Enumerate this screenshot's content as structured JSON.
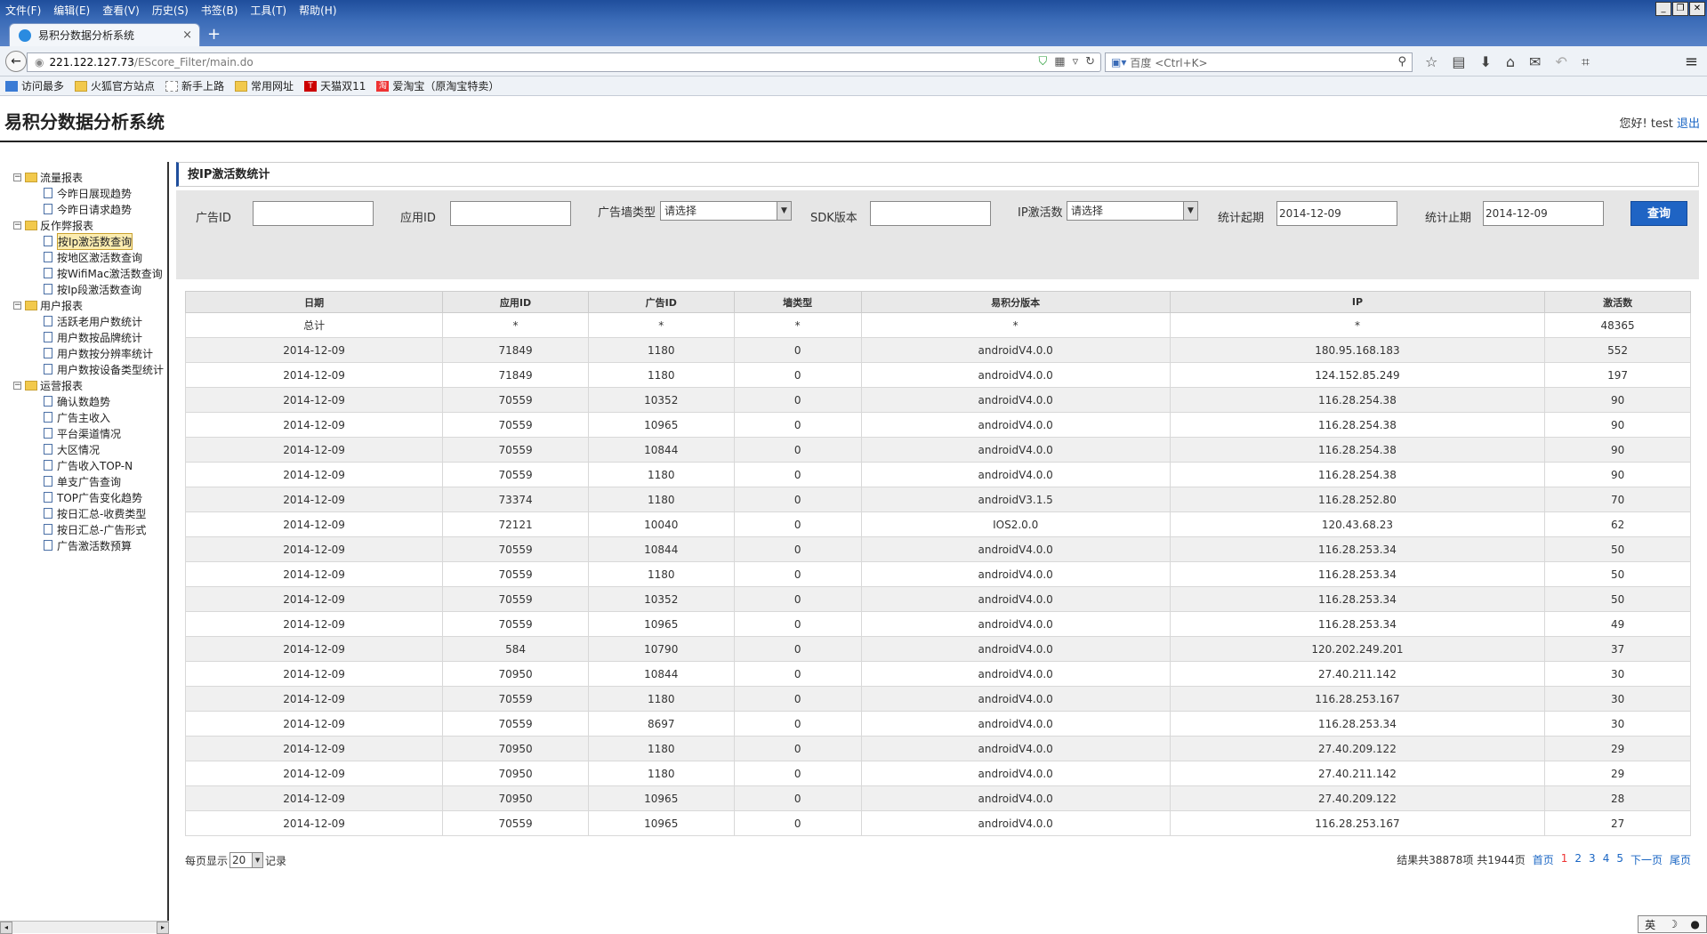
{
  "browser": {
    "menus": [
      "文件(F)",
      "编辑(E)",
      "查看(V)",
      "历史(S)",
      "书签(B)",
      "工具(T)",
      "帮助(H)"
    ],
    "tab_title": "易积分数据分析系统",
    "url_host": "221.122.127.73",
    "url_path": "/EScore_Filter/main.do",
    "search_placeholder": "百度 <Ctrl+K>",
    "bookmarks": [
      "访问最多",
      "火狐官方站点",
      "新手上路",
      "常用网址",
      "天猫双11",
      "爱淘宝（原淘宝特卖）"
    ]
  },
  "app": {
    "title": "易积分数据分析系统",
    "greeting": "您好! test",
    "logout": "退出"
  },
  "sidebar": {
    "groups": [
      {
        "label": "流量报表",
        "items": [
          "今昨日展现趋势",
          "今昨日请求趋势"
        ]
      },
      {
        "label": "反作弊报表",
        "items": [
          "按Ip激活数查询",
          "按地区激活数查询",
          "按WifiMac激活数查询",
          "按Ip段激活数查询"
        ]
      },
      {
        "label": "用户报表",
        "items": [
          "活跃老用户数统计",
          "用户数按品牌统计",
          "用户数按分辨率统计",
          "用户数按设备类型统计"
        ]
      },
      {
        "label": "运营报表",
        "items": [
          "确认数趋势",
          "广告主收入",
          "平台渠道情况",
          "大区情况",
          "广告收入TOP-N",
          "单支广告查询",
          "TOP广告变化趋势",
          "按日汇总-收费类型",
          "按日汇总-广告形式",
          "广告激活数预算"
        ]
      }
    ]
  },
  "panel": {
    "title": "按IP激活数统计",
    "filters": {
      "ad_id_label": "广告ID",
      "app_id_label": "应用ID",
      "wall_type_label": "广告墙类型",
      "wall_type_value": "请选择",
      "sdk_label": "SDK版本",
      "ip_act_label": "IP激活数",
      "ip_act_value": "请选择",
      "start_label": "统计起期",
      "start_value": "2014-12-09",
      "end_label": "统计止期",
      "end_value": "2014-12-09",
      "query_btn": "查询"
    },
    "table": {
      "headers": [
        "日期",
        "应用ID",
        "广告ID",
        "墙类型",
        "易积分版本",
        "IP",
        "激活数"
      ],
      "rows": [
        [
          "总计",
          "*",
          "*",
          "*",
          "*",
          "*",
          "48365"
        ],
        [
          "2014-12-09",
          "71849",
          "1180",
          "0",
          "androidV4.0.0",
          "180.95.168.183",
          "552"
        ],
        [
          "2014-12-09",
          "71849",
          "1180",
          "0",
          "androidV4.0.0",
          "124.152.85.249",
          "197"
        ],
        [
          "2014-12-09",
          "70559",
          "10352",
          "0",
          "androidV4.0.0",
          "116.28.254.38",
          "90"
        ],
        [
          "2014-12-09",
          "70559",
          "10965",
          "0",
          "androidV4.0.0",
          "116.28.254.38",
          "90"
        ],
        [
          "2014-12-09",
          "70559",
          "10844",
          "0",
          "androidV4.0.0",
          "116.28.254.38",
          "90"
        ],
        [
          "2014-12-09",
          "70559",
          "1180",
          "0",
          "androidV4.0.0",
          "116.28.254.38",
          "90"
        ],
        [
          "2014-12-09",
          "73374",
          "1180",
          "0",
          "androidV3.1.5",
          "116.28.252.80",
          "70"
        ],
        [
          "2014-12-09",
          "72121",
          "10040",
          "0",
          "IOS2.0.0",
          "120.43.68.23",
          "62"
        ],
        [
          "2014-12-09",
          "70559",
          "10844",
          "0",
          "androidV4.0.0",
          "116.28.253.34",
          "50"
        ],
        [
          "2014-12-09",
          "70559",
          "1180",
          "0",
          "androidV4.0.0",
          "116.28.253.34",
          "50"
        ],
        [
          "2014-12-09",
          "70559",
          "10352",
          "0",
          "androidV4.0.0",
          "116.28.253.34",
          "50"
        ],
        [
          "2014-12-09",
          "70559",
          "10965",
          "0",
          "androidV4.0.0",
          "116.28.253.34",
          "49"
        ],
        [
          "2014-12-09",
          "584",
          "10790",
          "0",
          "androidV4.0.0",
          "120.202.249.201",
          "37"
        ],
        [
          "2014-12-09",
          "70950",
          "10844",
          "0",
          "androidV4.0.0",
          "27.40.211.142",
          "30"
        ],
        [
          "2014-12-09",
          "70559",
          "1180",
          "0",
          "androidV4.0.0",
          "116.28.253.167",
          "30"
        ],
        [
          "2014-12-09",
          "70559",
          "8697",
          "0",
          "androidV4.0.0",
          "116.28.253.34",
          "30"
        ],
        [
          "2014-12-09",
          "70950",
          "1180",
          "0",
          "androidV4.0.0",
          "27.40.209.122",
          "29"
        ],
        [
          "2014-12-09",
          "70950",
          "1180",
          "0",
          "androidV4.0.0",
          "27.40.211.142",
          "29"
        ],
        [
          "2014-12-09",
          "70950",
          "10965",
          "0",
          "androidV4.0.0",
          "27.40.209.122",
          "28"
        ],
        [
          "2014-12-09",
          "70559",
          "10965",
          "0",
          "androidV4.0.0",
          "116.28.253.167",
          "27"
        ]
      ]
    },
    "pager": {
      "per_page_prefix": "每页显示",
      "per_page_value": "20",
      "per_page_suffix": "记录",
      "summary": "结果共38878项  共1944页",
      "first": "首页",
      "pages": [
        "1",
        "2",
        "3",
        "4",
        "5"
      ],
      "next": "下一页",
      "last": "尾页"
    }
  },
  "ime": "英"
}
